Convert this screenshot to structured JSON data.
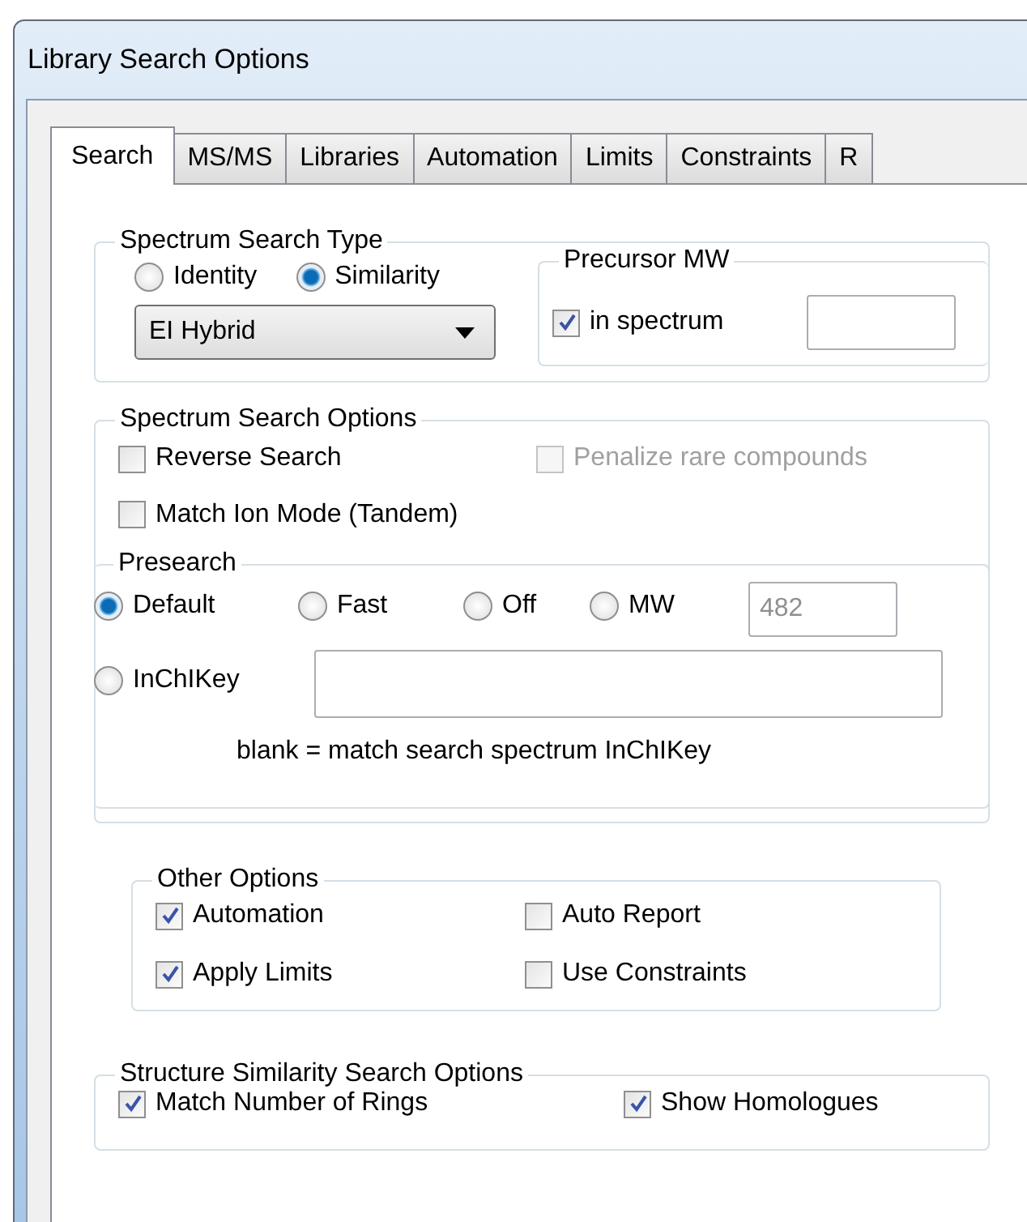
{
  "window": {
    "title": "Library Search Options"
  },
  "tabs": [
    {
      "label": "Search",
      "selected": true
    },
    {
      "label": "MS/MS",
      "selected": false
    },
    {
      "label": "Libraries",
      "selected": false
    },
    {
      "label": "Automation",
      "selected": false
    },
    {
      "label": "Limits",
      "selected": false
    },
    {
      "label": "Constraints",
      "selected": false
    },
    {
      "label": "R",
      "selected": false
    }
  ],
  "search_type": {
    "title": "Spectrum Search Type",
    "options": [
      {
        "label": "Identity",
        "selected": false
      },
      {
        "label": "Similarity",
        "selected": true
      }
    ],
    "dropdown": {
      "value": "EI Hybrid"
    },
    "precursor": {
      "title": "Precursor MW",
      "checkbox": {
        "label": "in spectrum",
        "checked": true
      }
    }
  },
  "search_options": {
    "title": "Spectrum Search Options",
    "checkboxes": [
      {
        "label": "Reverse Search",
        "checked": false,
        "disabled": false
      },
      {
        "label": "Penalize rare compounds",
        "checked": false,
        "disabled": true
      },
      {
        "label": "Match Ion Mode (Tandem)",
        "checked": false,
        "disabled": false
      }
    ],
    "presearch": {
      "title": "Presearch",
      "options": [
        {
          "label": "Default",
          "selected": true
        },
        {
          "label": "Fast",
          "selected": false
        },
        {
          "label": "Off",
          "selected": false
        },
        {
          "label": "MW",
          "selected": false
        },
        {
          "label": "InChIKey",
          "selected": false
        }
      ],
      "mw_field": {
        "value": "482",
        "disabled": true
      },
      "note": "blank = match search spectrum InChIKey"
    }
  },
  "other_options": {
    "title": "Other Options",
    "checkboxes": [
      {
        "label": "Automation",
        "checked": true
      },
      {
        "label": "Auto Report",
        "checked": false
      },
      {
        "label": "Apply Limits",
        "checked": true
      },
      {
        "label": "Use Constraints",
        "checked": false
      }
    ]
  },
  "structure_options": {
    "title": "Structure Similarity Search Options",
    "checkboxes": [
      {
        "label": "Match Number of Rings",
        "checked": true
      },
      {
        "label": "Show Homologues",
        "checked": true
      }
    ]
  }
}
